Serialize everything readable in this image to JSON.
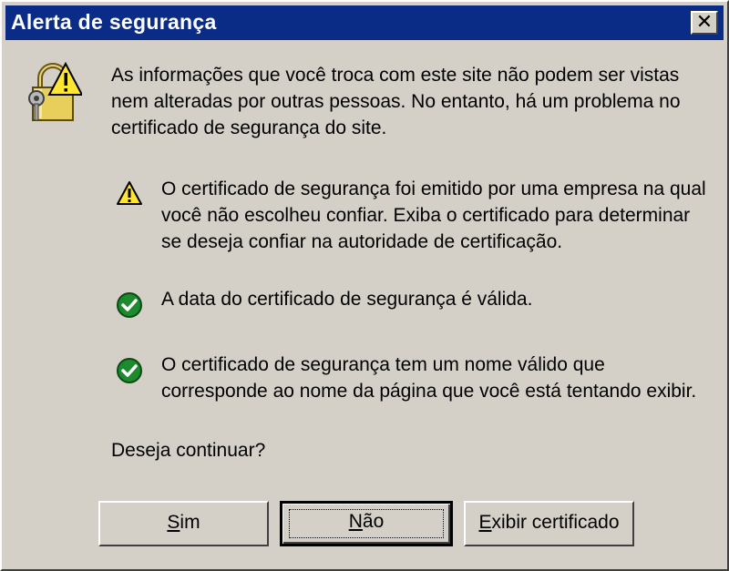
{
  "dialog": {
    "title": "Alerta de segurança",
    "close_label": "✕",
    "intro": "As informações que você troca com este site não podem ser vistas nem alteradas por outras pessoas. No entanto, há um problema no certificado de segurança do site.",
    "items": [
      {
        "icon": "warning-icon",
        "text": "O certificado de segurança foi emitido por uma empresa na qual você não escolheu confiar. Exiba o certificado para determinar se deseja confiar na autoridade de certificação."
      },
      {
        "icon": "check-icon",
        "text": "A data do certificado de segurança é válida."
      },
      {
        "icon": "check-icon",
        "text": "O certificado de segurança tem um nome válido que corresponde ao nome da página que você está tentando exibir."
      }
    ],
    "question": "Deseja continuar?",
    "buttons": {
      "yes": {
        "mnemonic": "S",
        "rest": "im"
      },
      "no": {
        "mnemonic": "N",
        "rest": "ão"
      },
      "cert": {
        "mnemonic": "E",
        "rest": "xibir certificado"
      }
    }
  },
  "colors": {
    "titlebar": "#0b2c86",
    "face": "#d4d0c8",
    "warning": "#ffe632",
    "ok": "#1e8a2e"
  }
}
